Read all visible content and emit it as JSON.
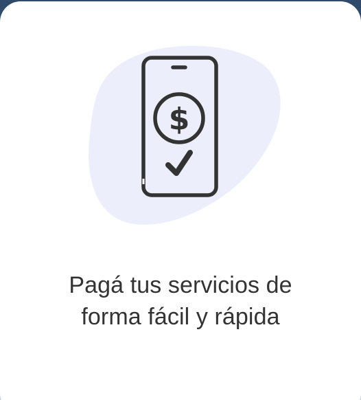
{
  "card": {
    "title_line1": "Pagá tus servicios de",
    "title_line2": "forma fácil y rápida"
  },
  "illustration": {
    "icon": "phone-payment-check-icon",
    "blob_color": "#eceefb",
    "stroke_color": "#333333"
  }
}
